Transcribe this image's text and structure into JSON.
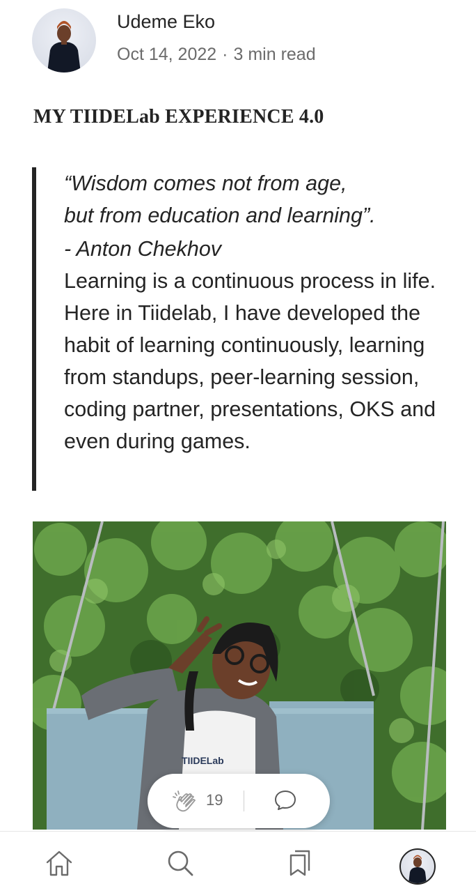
{
  "author": {
    "name": "Udeme Eko",
    "date": "Oct 14, 2022",
    "separator": "·",
    "read_time": "3 min read",
    "avatar_icon": "author-avatar"
  },
  "article": {
    "title": "MY TIIDELab EXPERIENCE 4.0",
    "quote_line1": "“Wisdom comes not from age,",
    "quote_line2": "but from education and learning”.",
    "quote_author": "- Anton Chekhov",
    "body": "Learning is a continuous process in life. Here in Tiidelab, I have developed the habit of learning continuously, learning from standups, peer-learning session, coding partner, presentations, OKS and even during games."
  },
  "image": {
    "shirt_text": "TIIDELab"
  },
  "actions": {
    "clap_count": "19",
    "clap_icon": "clap-icon",
    "comment_icon": "comment-icon"
  },
  "nav": {
    "items": [
      "home-icon",
      "search-icon",
      "bookmarks-icon",
      "profile-avatar"
    ]
  },
  "colors": {
    "text": "#242424",
    "muted": "#6b6b6b",
    "background": "#ffffff"
  }
}
